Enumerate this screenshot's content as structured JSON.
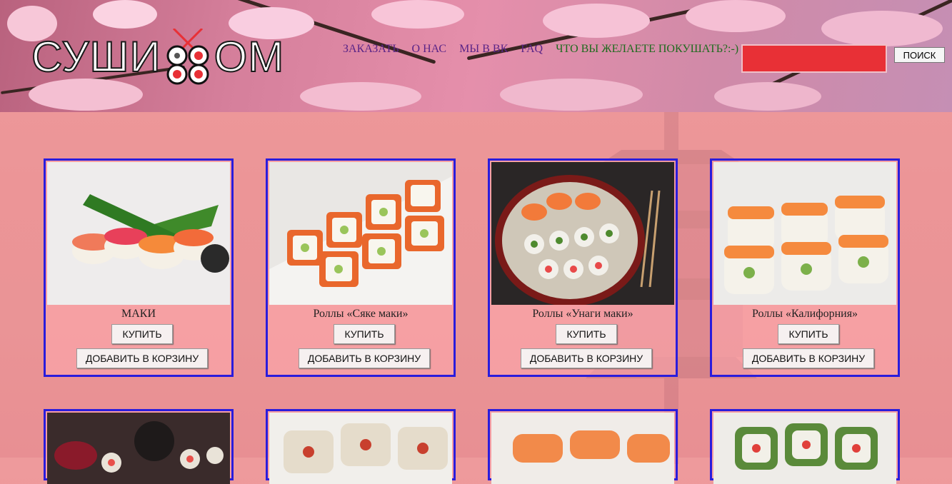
{
  "header": {
    "logo_text_left": "СУШИ",
    "logo_text_right": "ОМ",
    "nav": [
      {
        "label": "ЗАКАЗАТЬ"
      },
      {
        "label": "О НАС"
      },
      {
        "label": "МЫ В ВК"
      },
      {
        "label": "FAQ"
      }
    ],
    "question": "ЧТО ВЫ ЖЕЛАЕТЕ ПОКУШАТЬ?:-)",
    "search": {
      "value": "",
      "button_label": "ПОИСК"
    }
  },
  "products": [
    {
      "name": "МАКИ",
      "buy_label": "КУПИТЬ",
      "cart_label": "ДОБАВИТЬ В КОРЗИНУ"
    },
    {
      "name": "Роллы «Сяке маки»",
      "buy_label": "КУПИТЬ",
      "cart_label": "ДОБАВИТЬ В КОРЗИНУ"
    },
    {
      "name": "Роллы «Унаги маки»",
      "buy_label": "КУПИТЬ",
      "cart_label": "ДОБАВИТЬ В КОРЗИНУ"
    },
    {
      "name": "Роллы «Калифорния»",
      "buy_label": "КУПИТЬ",
      "cart_label": "ДОБАВИТЬ В КОРЗИНУ"
    }
  ],
  "colors": {
    "card_border": "#2a1cdc",
    "search_fill": "#e83036",
    "nav": "#5a2487",
    "question": "#1e6b1e"
  }
}
